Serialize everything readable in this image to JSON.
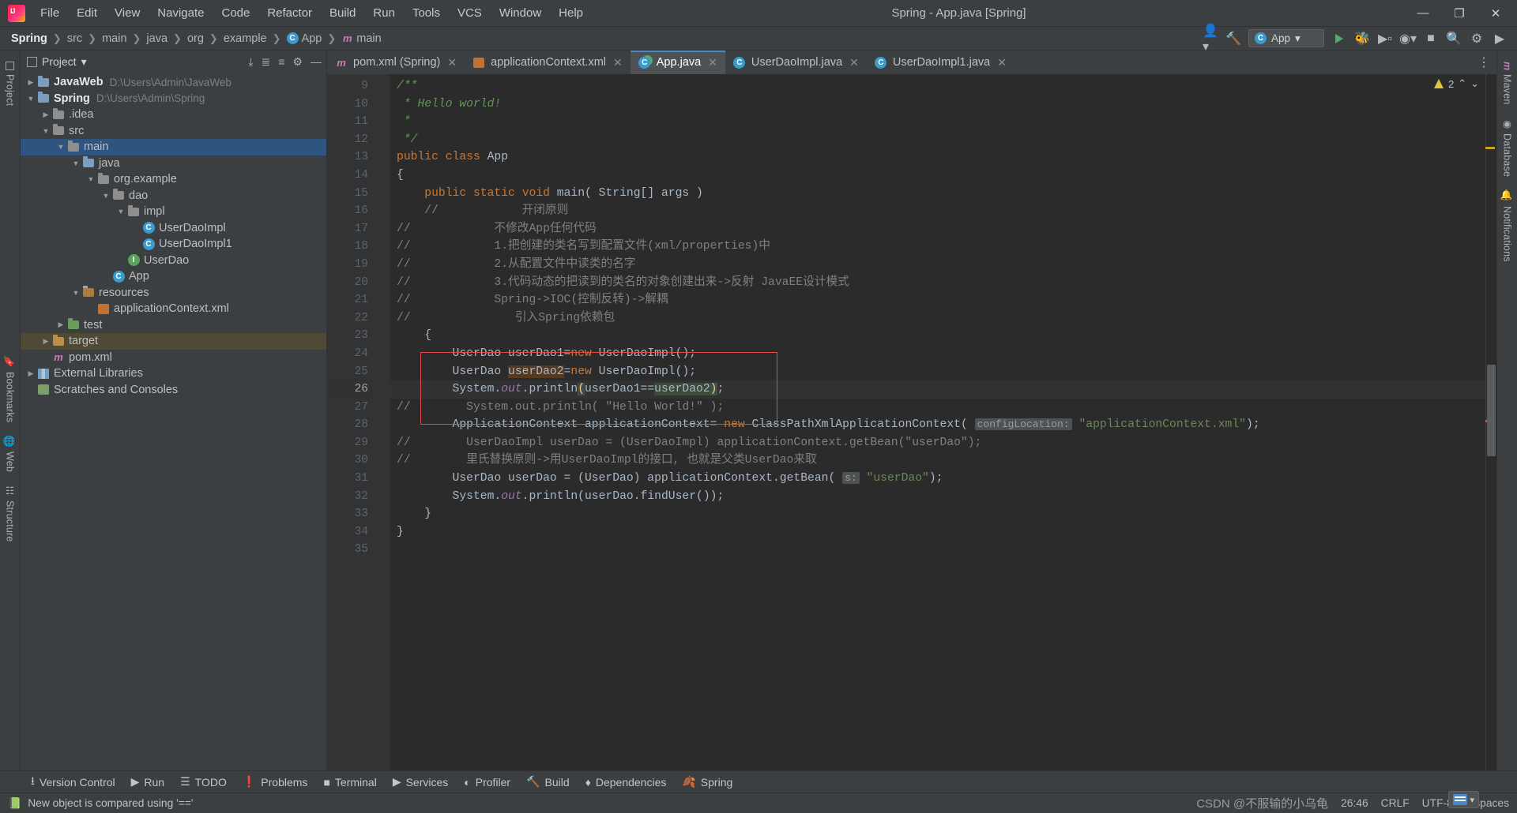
{
  "titlebar": {
    "logo": "intellij-idea-logo",
    "menus": [
      "File",
      "Edit",
      "View",
      "Navigate",
      "Code",
      "Refactor",
      "Build",
      "Run",
      "Tools",
      "VCS",
      "Window",
      "Help"
    ],
    "window_title": "Spring - App.java [Spring]",
    "minimize": "—",
    "maximize": "❐",
    "close": "✕"
  },
  "navbar": {
    "breadcrumbs": [
      "Spring",
      "src",
      "main",
      "java",
      "org",
      "example",
      "App",
      "main"
    ],
    "separator": "❯",
    "run_config": "App",
    "right_icons": [
      "user-icon",
      "hammer-build-icon",
      "run-icon",
      "debug-icon",
      "run-coverage-icon",
      "profile-icon",
      "stop-icon",
      "search-icon",
      "settings-gear-icon",
      "updates-icon"
    ]
  },
  "left_rail": [
    "Project",
    "Bookmarks",
    "Web",
    "Structure"
  ],
  "right_rail": [
    "Maven",
    "Database",
    "Notifications"
  ],
  "project_panel": {
    "title": "Project",
    "actions": [
      "expand-all-icon",
      "collapse-all-icon",
      "settings-gear-icon",
      "hide-icon"
    ],
    "tree": [
      {
        "indent": 0,
        "arrow": "▶",
        "icon": "folder-blue",
        "label": "JavaWeb",
        "bold": true,
        "sub": "D:\\Users\\Admin\\JavaWeb",
        "state": "none"
      },
      {
        "indent": 0,
        "arrow": "▼",
        "icon": "folder-blue",
        "label": "Spring",
        "bold": true,
        "sub": "D:\\Users\\Admin\\Spring",
        "state": "none"
      },
      {
        "indent": 1,
        "arrow": "▶",
        "icon": "folder-grey",
        "label": ".idea",
        "bold": false,
        "sub": "",
        "state": "none"
      },
      {
        "indent": 1,
        "arrow": "▼",
        "icon": "folder-grey",
        "label": "src",
        "bold": false,
        "sub": "",
        "state": "none"
      },
      {
        "indent": 2,
        "arrow": "▼",
        "icon": "folder-grey",
        "label": "main",
        "bold": false,
        "sub": "",
        "state": "selected"
      },
      {
        "indent": 3,
        "arrow": "▼",
        "icon": "folder-blue",
        "label": "java",
        "bold": false,
        "sub": "",
        "state": "none"
      },
      {
        "indent": 4,
        "arrow": "▼",
        "icon": "folder-grey",
        "label": "org.example",
        "bold": false,
        "sub": "",
        "state": "none"
      },
      {
        "indent": 5,
        "arrow": "▼",
        "icon": "folder-grey",
        "label": "dao",
        "bold": false,
        "sub": "",
        "state": "none"
      },
      {
        "indent": 6,
        "arrow": "▼",
        "icon": "folder-grey",
        "label": "impl",
        "bold": false,
        "sub": "",
        "state": "none"
      },
      {
        "indent": 7,
        "arrow": "",
        "icon": "class-icon",
        "label": "UserDaoImpl",
        "bold": false,
        "sub": "",
        "state": "none"
      },
      {
        "indent": 7,
        "arrow": "",
        "icon": "class-icon",
        "label": "UserDaoImpl1",
        "bold": false,
        "sub": "",
        "state": "none"
      },
      {
        "indent": 6,
        "arrow": "",
        "icon": "interface-icon",
        "label": "UserDao",
        "bold": false,
        "sub": "",
        "state": "none"
      },
      {
        "indent": 5,
        "arrow": "",
        "icon": "class-icon",
        "label": "App",
        "bold": false,
        "sub": "",
        "state": "none"
      },
      {
        "indent": 3,
        "arrow": "▼",
        "icon": "folder-resources",
        "label": "resources",
        "bold": false,
        "sub": "",
        "state": "none"
      },
      {
        "indent": 4,
        "arrow": "",
        "icon": "spring-xml-icon",
        "label": "applicationContext.xml",
        "bold": false,
        "sub": "",
        "state": "none"
      },
      {
        "indent": 2,
        "arrow": "▶",
        "icon": "folder-green",
        "label": "test",
        "bold": false,
        "sub": "",
        "state": "none"
      },
      {
        "indent": 1,
        "arrow": "▶",
        "icon": "folder-orange",
        "label": "target",
        "bold": false,
        "sub": "",
        "state": "highlighted"
      },
      {
        "indent": 1,
        "arrow": "",
        "icon": "maven-icon",
        "label": "pom.xml",
        "bold": false,
        "sub": "",
        "state": "none"
      },
      {
        "indent": 0,
        "arrow": "▶",
        "icon": "library-icon",
        "label": "External Libraries",
        "bold": false,
        "sub": "",
        "state": "none"
      },
      {
        "indent": 0,
        "arrow": "",
        "icon": "scratches-icon",
        "label": "Scratches and Consoles",
        "bold": false,
        "sub": "",
        "state": "none"
      }
    ]
  },
  "tabs": [
    {
      "label": "pom.xml (Spring)",
      "icon": "maven-icon",
      "active": false,
      "close": "✕"
    },
    {
      "label": "applicationContext.xml",
      "icon": "spring-xml-icon",
      "active": false,
      "close": "✕"
    },
    {
      "label": "App.java",
      "icon": "class-run-icon",
      "active": true,
      "close": "✕"
    },
    {
      "label": "UserDaoImpl.java",
      "icon": "class-icon",
      "active": false,
      "close": "✕"
    },
    {
      "label": "UserDaoImpl1.java",
      "icon": "class-icon",
      "active": false,
      "close": "✕"
    }
  ],
  "inspection": {
    "warning_count": "2",
    "up": "⌃",
    "down": "⌄",
    "checkmark": "✓"
  },
  "editor": {
    "first_line": 9,
    "lines": [
      {
        "n": 9,
        "runmark": false,
        "fold": "minus",
        "current": false
      },
      {
        "n": 10,
        "runmark": false,
        "fold": "",
        "current": false
      },
      {
        "n": 11,
        "runmark": false,
        "fold": "",
        "current": false
      },
      {
        "n": 12,
        "runmark": false,
        "fold": "end",
        "current": false
      },
      {
        "n": 13,
        "runmark": true,
        "fold": "",
        "current": false
      },
      {
        "n": 14,
        "runmark": false,
        "fold": "",
        "current": false
      },
      {
        "n": 15,
        "runmark": true,
        "fold": "",
        "current": false
      },
      {
        "n": 16,
        "runmark": false,
        "fold": "minus",
        "current": false
      },
      {
        "n": 17,
        "runmark": false,
        "fold": "",
        "current": false
      },
      {
        "n": 18,
        "runmark": false,
        "fold": "",
        "current": false
      },
      {
        "n": 19,
        "runmark": false,
        "fold": "",
        "current": false
      },
      {
        "n": 20,
        "runmark": false,
        "fold": "",
        "current": false
      },
      {
        "n": 21,
        "runmark": false,
        "fold": "",
        "current": false
      },
      {
        "n": 22,
        "runmark": false,
        "fold": "end",
        "current": false
      },
      {
        "n": 23,
        "runmark": false,
        "fold": "minus",
        "current": false
      },
      {
        "n": 24,
        "runmark": false,
        "fold": "",
        "current": false
      },
      {
        "n": 25,
        "runmark": false,
        "fold": "",
        "current": false
      },
      {
        "n": 26,
        "runmark": false,
        "fold": "",
        "current": true
      },
      {
        "n": 27,
        "runmark": false,
        "fold": "",
        "current": false
      },
      {
        "n": 28,
        "runmark": false,
        "fold": "",
        "current": false
      },
      {
        "n": 29,
        "runmark": false,
        "fold": "minus",
        "current": false
      },
      {
        "n": 30,
        "runmark": false,
        "fold": "end",
        "current": false
      },
      {
        "n": 31,
        "runmark": false,
        "fold": "",
        "current": false
      },
      {
        "n": 32,
        "runmark": false,
        "fold": "",
        "current": false
      },
      {
        "n": 33,
        "runmark": false,
        "fold": "end",
        "current": false
      },
      {
        "n": 34,
        "runmark": false,
        "fold": "",
        "current": false
      },
      {
        "n": 35,
        "runmark": false,
        "fold": "",
        "current": false
      }
    ],
    "code_text": [
      "/**",
      " * Hello world!",
      " *",
      " */",
      "public class App",
      "{",
      "    public static void main( String[] args )",
      "    //            开闭原则",
      "//            不修改App任何代码",
      "//            1.把创建的类名写到配置文件(xml/properties)中",
      "//            2.从配置文件中读类的名字",
      "//            3.代码动态的把读到的类名的对象创建出来->反射 JavaEE设计模式",
      "//            Spring->IOC(控制反转)->解耦",
      "//               引入Spring依赖包",
      "    {",
      "        UserDao userDao1=new UserDaoImpl();",
      "        UserDao userDao2=new UserDaoImpl();",
      "        System.out.println(userDao1==userDao2);",
      "//        System.out.println( \"Hello World!\" );",
      "        ApplicationContext applicationContext= new ClassPathXmlApplicationContext( configLocation: \"applicationContext.xml\");",
      "//        UserDaoImpl userDao = (UserDaoImpl) applicationContext.getBean(\"userDao\");",
      "//        里氏替换原则->用UserDaoImpl的接口, 也就是父类UserDao来取",
      "        UserDao userDao = (UserDao) applicationContext.getBean( s: \"userDao\");",
      "        System.out.println(userDao.findUser());",
      "    }",
      "}",
      ""
    ],
    "param_hint_1": "configLocation:",
    "param_hint_2": "s:"
  },
  "bottom_toolwindows": [
    {
      "label": "Version Control",
      "icon": "branch-icon"
    },
    {
      "label": "Run",
      "icon": "run-icon"
    },
    {
      "label": "TODO",
      "icon": "todo-list-icon"
    },
    {
      "label": "Problems",
      "icon": "problems-icon"
    },
    {
      "label": "Terminal",
      "icon": "terminal-icon"
    },
    {
      "label": "Services",
      "icon": "services-icon"
    },
    {
      "label": "Profiler",
      "icon": "profiler-icon"
    },
    {
      "label": "Build",
      "icon": "build-hammer-icon"
    },
    {
      "label": "Dependencies",
      "icon": "dependencies-icon"
    },
    {
      "label": "Spring",
      "icon": "spring-leaf-icon"
    }
  ],
  "statusbar": {
    "message": "New object is compared using '=='",
    "message_icon": "book-icon",
    "caret_position": "26:46",
    "line_separator": "CRLF",
    "encoding": "UTF-8",
    "indent": "4 spaces",
    "watermark": "CSDN @不服输的小乌龟"
  }
}
